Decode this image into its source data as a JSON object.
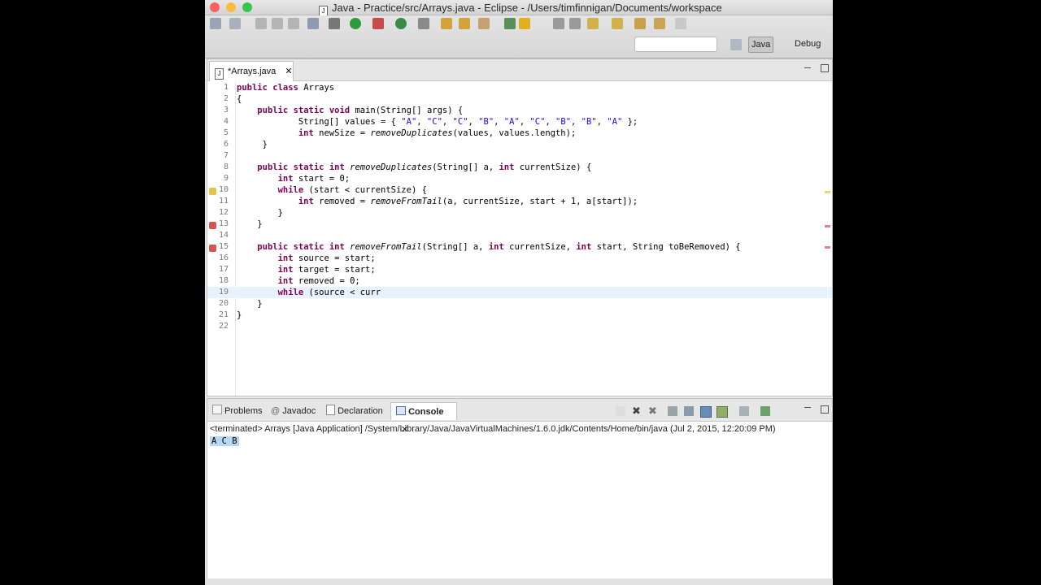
{
  "window": {
    "title": "Java - Practice/src/Arrays.java - Eclipse - /Users/timfinnigan/Documents/workspace"
  },
  "toolbar": {
    "search_placeholder": ""
  },
  "perspectives": {
    "java": "Java",
    "debug": "Debug"
  },
  "editor": {
    "tab_label": "*Arrays.java",
    "lines": [
      "public class Arrays",
      "{",
      "    public static void main(String[] args) {",
      "            String[] values = { \"A\", \"C\", \"C\", \"B\", \"A\", \"C\", \"B\", \"B\", \"A\" };",
      "            int newSize = removeDuplicates(values, values.length);",
      "     }",
      "",
      "    public static int removeDuplicates(String[] a, int currentSize) {",
      "        int start = 0;",
      "        while (start < currentSize) {",
      "            int removed = removeFromTail(a, currentSize, start + 1, a[start]);",
      "        }",
      "    }",
      "",
      "    public static int removeFromTail(String[] a, int currentSize, int start, String toBeRemoved) {",
      "        int source = start;",
      "        int target = start;",
      "        int removed = 0;",
      "        while (source < curr",
      "    }",
      "}",
      ""
    ]
  },
  "console_panel": {
    "tabs": [
      "Problems",
      "Javadoc",
      "Declaration",
      "Console"
    ],
    "terminated_line": "<terminated> Arrays [Java Application] /System/Library/Java/JavaVirtualMachines/1.6.0.jdk/Contents/Home/bin/java (Jul 2, 2015, 12:20:09 PM)",
    "output": "A C B"
  }
}
